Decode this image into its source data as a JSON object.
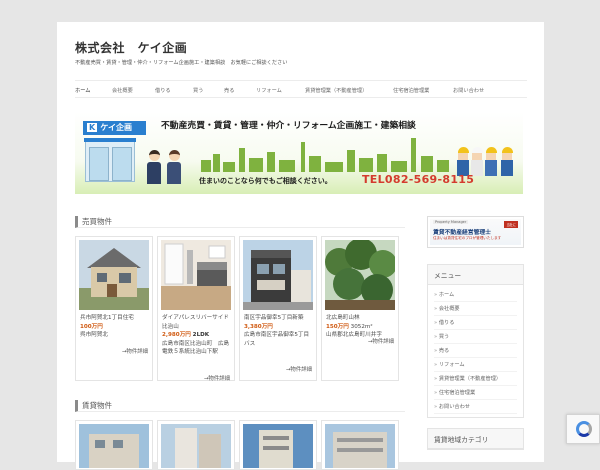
{
  "site": {
    "title": "株式会社　ケイ企画",
    "description": "不動産売買・賃貸・管理・仲介・リフォーム企画施工・建築相談　お気軽にご相談ください"
  },
  "nav": {
    "items": [
      {
        "label": "ホーム",
        "active": true
      },
      {
        "label": "会社概要"
      },
      {
        "label": "借りる"
      },
      {
        "label": "買う"
      },
      {
        "label": "売る"
      },
      {
        "label": "リフォーム"
      },
      {
        "label": "賃貸管理業（不動産管理）"
      },
      {
        "label": "住宅宿泊管理業"
      },
      {
        "label": "お問い合わせ"
      }
    ]
  },
  "banner": {
    "logo_mark": "K",
    "logo_text": "ケイ企画",
    "headline": "不動産売買・賃貸・管理・仲介・リフォーム企画施工・建築相談",
    "bottom_line": "住まいのことなら何でもご相談ください。",
    "tel": "TEL082-569-8115"
  },
  "sections": {
    "sale": {
      "title": "売買物件",
      "listings": [
        {
          "name": "兵市阿賀北1丁目住宅",
          "price": "100万円",
          "detail": "呉市阿賀北",
          "more": "→物件詳細"
        },
        {
          "name": "ダイアパレスリバーサイド比治山",
          "price": "2,980万円",
          "layout": "2LDK",
          "detail": "広島市南区比治山町　広島電鉄５系統比治山下駅",
          "more": "→物件詳細"
        },
        {
          "name": "南区宇品御幸5丁目新築",
          "price": "3,380万円",
          "detail": "広島市南区宇品御幸5丁目　バス",
          "more": "→物件詳細"
        },
        {
          "name": "北広島町山林",
          "price": "150万円",
          "area": "3052m²",
          "detail": "山県郡北広島町川井字",
          "more": "→物件詳細"
        }
      ]
    },
    "rent": {
      "title": "賃貸物件"
    }
  },
  "sidebar": {
    "banner": {
      "badge_top": "Property Manager",
      "title": "賃貸不動産経営管理士",
      "subtitle": "住まいは賃貸住宅のプロが管理いたします",
      "tag": "当社に"
    },
    "menu": {
      "title": "メニュー",
      "items": [
        "ホーム",
        "会社概要",
        "借りる",
        "買う",
        "売る",
        "リフォーム",
        "賃貸管理業（不動産管理）",
        "住宅宿泊管理業",
        "お問い合わせ"
      ]
    },
    "rent_area": {
      "title": "賃貸地域カテゴリ"
    }
  },
  "colors": {
    "price": "#d05a12",
    "tel": "#d43b2e",
    "logo": "#2a7fcf"
  }
}
